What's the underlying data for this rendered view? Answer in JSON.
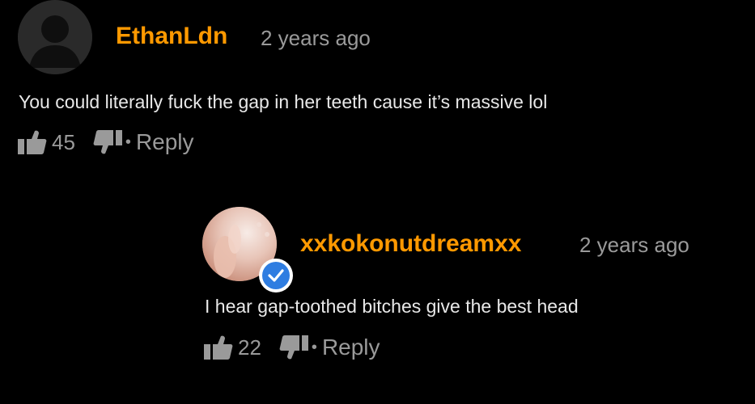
{
  "comments": [
    {
      "username": "EthanLdn",
      "timestamp": "2 years ago",
      "text": "You could literally fuck the gap in her teeth cause it’s massive lol",
      "likes": "45",
      "reply_label": "Reply",
      "separator": "•",
      "avatar_icon": "default-user-avatar",
      "verified": false
    },
    {
      "username": "xxkokonutdreamxx",
      "timestamp": "2 years ago",
      "text": "I hear gap-toothed bitches give the best head",
      "likes": "22",
      "reply_label": "Reply",
      "separator": "•",
      "avatar_icon": "user-photo-avatar",
      "verified": true
    }
  ],
  "colors": {
    "background": "#000000",
    "username": "#ff9900",
    "meta": "#9a9a9a",
    "text": "#e8e8e8",
    "verified_badge": "#2f7de1"
  },
  "icons": {
    "like": "thumbs-up-icon",
    "dislike": "thumbs-down-icon",
    "verified": "verified-check-icon"
  }
}
